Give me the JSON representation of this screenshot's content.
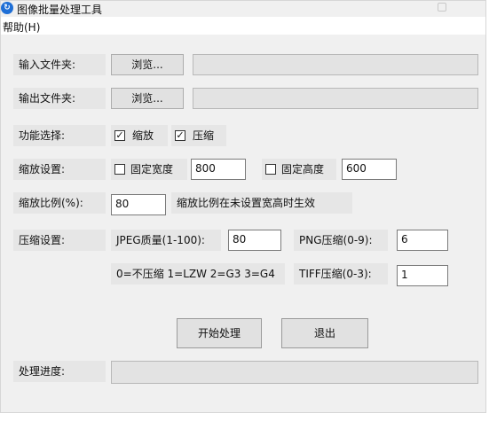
{
  "window": {
    "title": "图像批量处理工具",
    "icon": "app-icon"
  },
  "menu": {
    "help": "帮助(H)"
  },
  "input_folder": {
    "label": "输入文件夹:",
    "browse": "浏览...",
    "value": ""
  },
  "output_folder": {
    "label": "输出文件夹:",
    "browse": "浏览...",
    "value": ""
  },
  "function": {
    "label": "功能选择:",
    "scale_label": "缩放",
    "scale_checked": true,
    "compress_label": "压缩",
    "compress_checked": true
  },
  "scale_settings": {
    "label": "缩放设置:",
    "fixed_width_label": "固定宽度",
    "fixed_width_checked": false,
    "width": "800",
    "fixed_height_label": "固定高度",
    "fixed_height_checked": false,
    "height": "600"
  },
  "scale_ratio": {
    "label": "缩放比例(%):",
    "value": "80",
    "hint": "缩放比例在未设置宽高时生效"
  },
  "compress": {
    "label": "压缩设置:",
    "jpeg_label": "JPEG质量(1-100):",
    "jpeg_value": "80",
    "png_label": "PNG压缩(0-9):",
    "png_value": "6",
    "tiff_hint": "0=不压缩 1=LZW 2=G3 3=G4",
    "tiff_label": "TIFF压缩(0-3):",
    "tiff_value": "1"
  },
  "actions": {
    "start": "开始处理",
    "exit": "退出"
  },
  "progress": {
    "label": "处理进度:",
    "percent": 0
  },
  "colors": {
    "window_bg": "#f0f0f0",
    "label_bg": "#e6e6e6",
    "accent": "#1f6fd6"
  }
}
